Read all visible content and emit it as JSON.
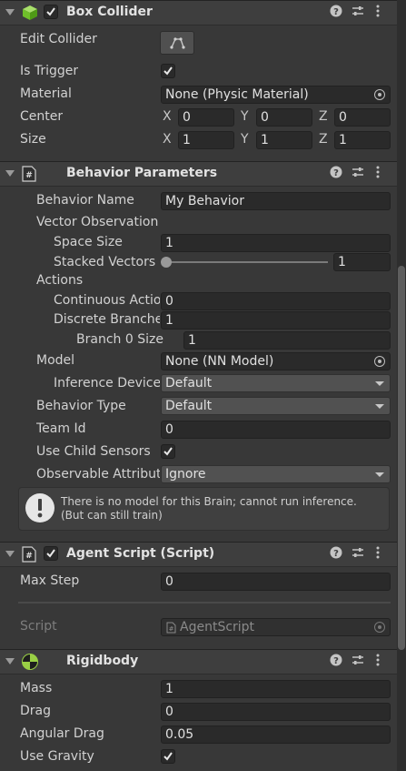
{
  "box_collider": {
    "title": "Box Collider",
    "edit_collider_label": "Edit Collider",
    "is_trigger_label": "Is Trigger",
    "material_label": "Material",
    "material_value": "None (Physic Material)",
    "center_label": "Center",
    "center": {
      "x": "0",
      "y": "0",
      "z": "0"
    },
    "size_label": "Size",
    "size": {
      "x": "1",
      "y": "1",
      "z": "1"
    },
    "axis_x": "X",
    "axis_y": "Y",
    "axis_z": "Z"
  },
  "behavior_parameters": {
    "title": "Behavior Parameters",
    "behavior_name_label": "Behavior Name",
    "behavior_name_value": "My Behavior",
    "vector_observation_label": "Vector Observation",
    "space_size_label": "Space Size",
    "space_size_value": "1",
    "stacked_vectors_label": "Stacked Vectors",
    "stacked_vectors_value": "1",
    "actions_label": "Actions",
    "continuous_actions_label": "Continuous Actions",
    "continuous_actions_value": "0",
    "discrete_branches_label": "Discrete Branches",
    "discrete_branches_value": "1",
    "branch0_size_label": "Branch 0 Size",
    "branch0_size_value": "1",
    "model_label": "Model",
    "model_value": "None (NN Model)",
    "inference_device_label": "Inference Device",
    "inference_device_value": "Default",
    "behavior_type_label": "Behavior Type",
    "behavior_type_value": "Default",
    "team_id_label": "Team Id",
    "team_id_value": "0",
    "use_child_sensors_label": "Use Child Sensors",
    "observable_attribute_label": "Observable Attribute Handling",
    "observable_attribute_value": "Ignore",
    "help_text_line1": "There is no model for this Brain; cannot run inference.",
    "help_text_line2": "(But can still train)"
  },
  "agent_script": {
    "title": "Agent Script (Script)",
    "max_step_label": "Max Step",
    "max_step_value": "0",
    "script_label": "Script",
    "script_value": "AgentScript"
  },
  "rigidbody": {
    "title": "Rigidbody",
    "mass_label": "Mass",
    "mass_value": "1",
    "drag_label": "Drag",
    "drag_value": "0",
    "angular_drag_label": "Angular Drag",
    "angular_drag_value": "0.05",
    "use_gravity_label": "Use Gravity"
  },
  "icons": [
    "help-icon",
    "presets-icon",
    "kebab-menu-icon",
    "object-picker-icon",
    "checkmark-icon",
    "edit-collider-icon",
    "script-icon",
    "cube-icon",
    "rigidbody-icon",
    "info-icon"
  ]
}
